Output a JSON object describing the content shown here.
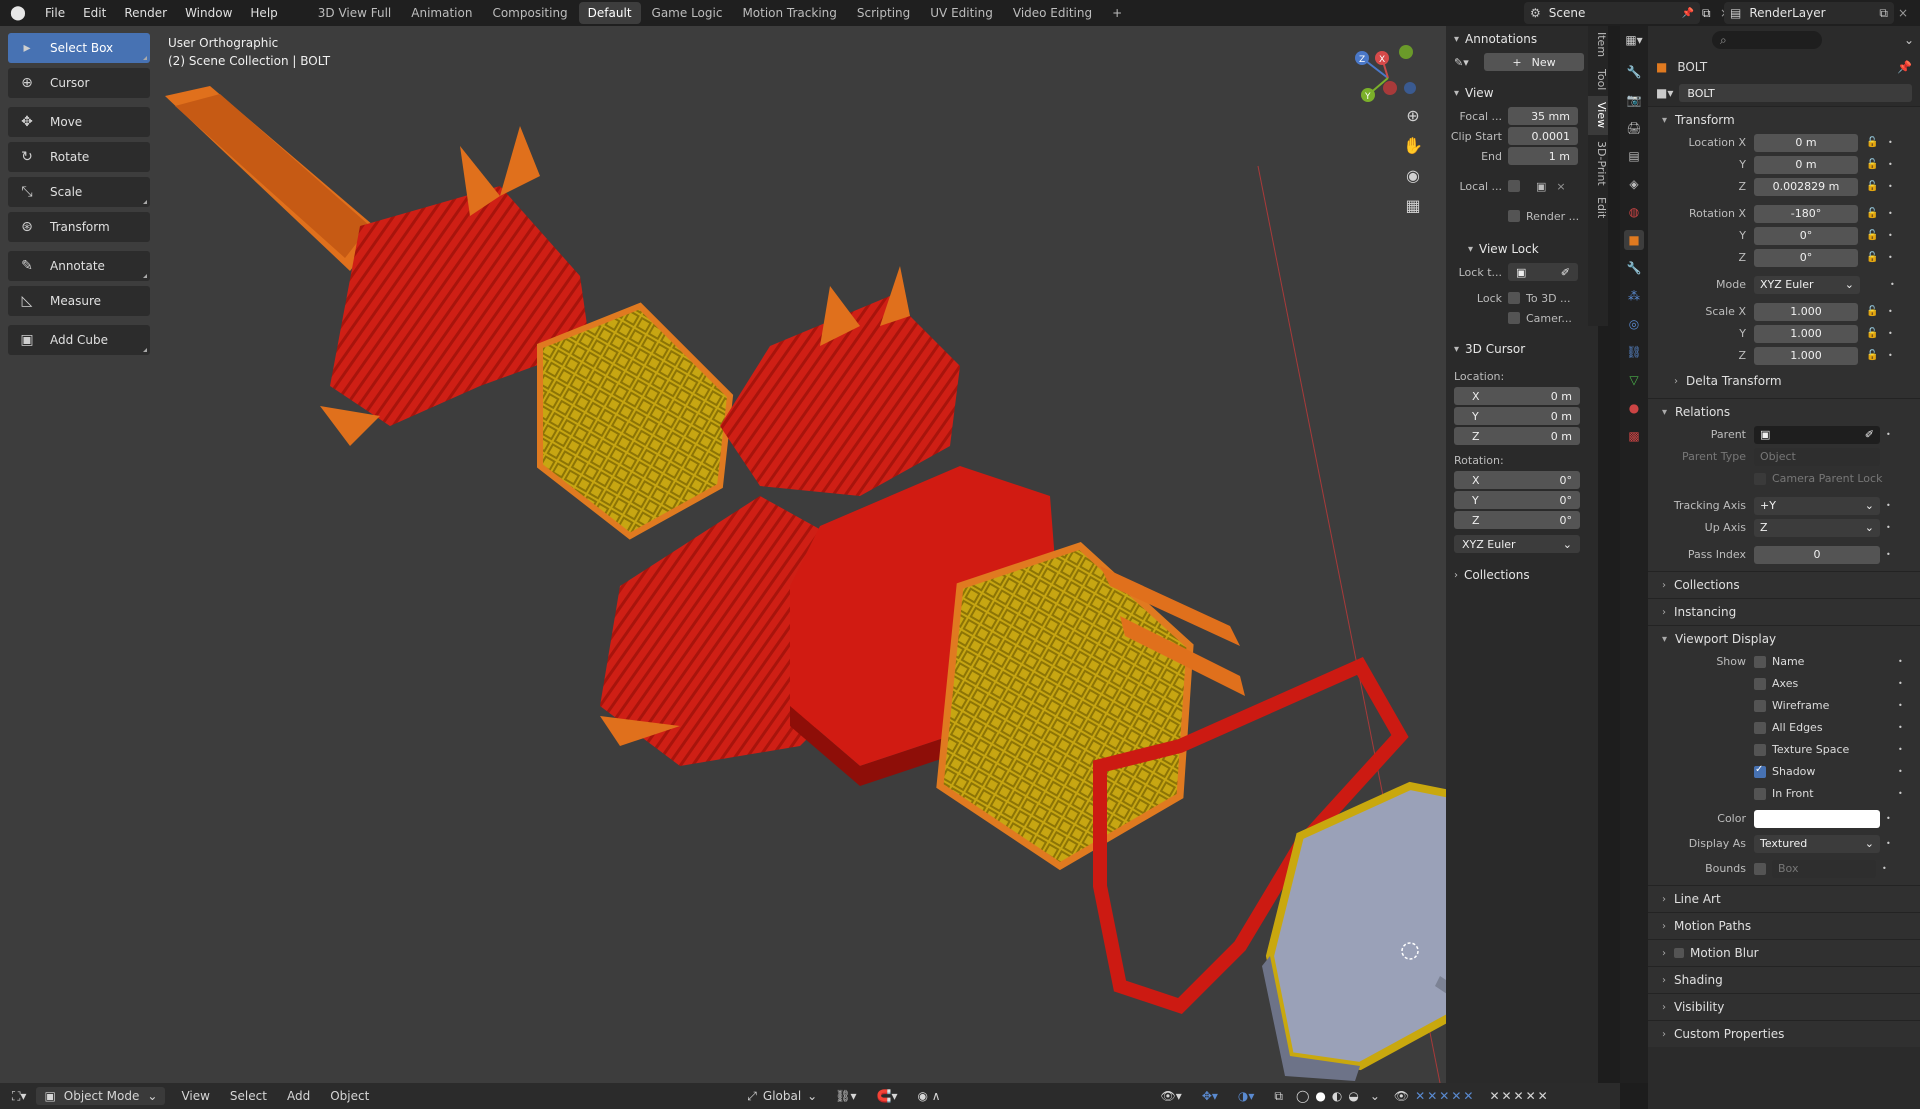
{
  "topbar": {
    "menus": [
      "File",
      "Edit",
      "Render",
      "Window",
      "Help"
    ],
    "workspaces": [
      "3D View Full",
      "Animation",
      "Compositing",
      "Default",
      "Game Logic",
      "Motion Tracking",
      "Scripting",
      "UV Editing",
      "Video Editing"
    ],
    "active_workspace": "Default",
    "add_workspace": "+",
    "scene": "Scene",
    "render_layer": "RenderLayer"
  },
  "toolbar": {
    "tools": [
      {
        "label": "Select Box",
        "icon": "select-box-icon",
        "glyph": "▸"
      },
      {
        "label": "Cursor",
        "icon": "cursor-icon",
        "glyph": "⊕"
      },
      {
        "label": "Move",
        "icon": "move-icon",
        "glyph": "✥"
      },
      {
        "label": "Rotate",
        "icon": "rotate-icon",
        "glyph": "↻"
      },
      {
        "label": "Scale",
        "icon": "scale-icon",
        "glyph": "⤡"
      },
      {
        "label": "Transform",
        "icon": "transform-icon",
        "glyph": "⊛"
      },
      {
        "label": "Annotate",
        "icon": "annotate-icon",
        "glyph": "✎"
      },
      {
        "label": "Measure",
        "icon": "measure-icon",
        "glyph": "📐"
      },
      {
        "label": "Add Cube",
        "icon": "add-cube-icon",
        "glyph": "▣"
      }
    ]
  },
  "viewport": {
    "view_name": "User Orthographic",
    "collection": "(2) Scene Collection | BOLT"
  },
  "npanel": {
    "annotations_title": "Annotations",
    "new_label": "New",
    "view_title": "View",
    "focal_label": "Focal ...",
    "focal_value": "35 mm",
    "clip_start_label": "Clip Start",
    "clip_start_value": "0.0001",
    "end_label": "End",
    "end_value": "1 m",
    "local_label": "Local ...",
    "render_label": "Render ...",
    "view_lock_title": "View Lock",
    "lock_to_label": "Lock t...",
    "lock_label": "Lock",
    "to_3d_label": "To 3D ...",
    "camera_label": "Camer...",
    "cursor_title": "3D Cursor",
    "location_label": "Location:",
    "loc_x": "0 m",
    "loc_y": "0 m",
    "loc_z": "0 m",
    "rotation_label": "Rotation:",
    "rot_x": "0°",
    "rot_y": "0°",
    "rot_z": "0°",
    "rot_mode": "XYZ Euler",
    "collections_title": "Collections",
    "x": "X",
    "y": "Y",
    "z": "Z",
    "tabs": [
      "Item",
      "Tool",
      "View",
      "3D-Print",
      "Edit"
    ]
  },
  "props": {
    "object_name": "BOLT",
    "data_name": "BOLT",
    "transform_title": "Transform",
    "location_x_label": "Location X",
    "location_x": "0 m",
    "location_y": "0 m",
    "location_z": "0.002829 m",
    "rotation_x_label": "Rotation X",
    "rotation_x": "-180°",
    "rotation_y": "0°",
    "rotation_z": "0°",
    "mode_label": "Mode",
    "mode_value": "XYZ Euler",
    "scale_x_label": "Scale X",
    "scale_x": "1.000",
    "scale_y": "1.000",
    "scale_z": "1.000",
    "y_label": "Y",
    "z_label": "Z",
    "delta_title": "Delta Transform",
    "relations_title": "Relations",
    "parent_label": "Parent",
    "parent_type_label": "Parent Type",
    "parent_type_value": "Object",
    "camera_parent_lock": "Camera Parent Lock",
    "tracking_axis_label": "Tracking Axis",
    "tracking_axis_value": "+Y",
    "up_axis_label": "Up Axis",
    "up_axis_value": "Z",
    "pass_index_label": "Pass Index",
    "pass_index_value": "0",
    "collections_title": "Collections",
    "instancing_title": "Instancing",
    "viewport_display_title": "Viewport Display",
    "show_label": "Show",
    "show_name": "Name",
    "show_axes": "Axes",
    "show_wireframe": "Wireframe",
    "show_all_edges": "All Edges",
    "show_texture_space": "Texture Space",
    "show_shadow": "Shadow",
    "show_in_front": "In Front",
    "color_label": "Color",
    "display_as_label": "Display As",
    "display_as_value": "Textured",
    "bounds_label": "Bounds",
    "bounds_value": "Box",
    "line_art_title": "Line Art",
    "motion_paths_title": "Motion Paths",
    "motion_blur_title": "Motion Blur",
    "shading_title": "Shading",
    "visibility_title": "Visibility",
    "custom_props_title": "Custom Properties"
  },
  "statusbar": {
    "mode": "Object Mode",
    "menus": [
      "View",
      "Select",
      "Add",
      "Object"
    ],
    "orientation": "Global"
  },
  "colors": {
    "accent": "#4772b3",
    "model_red": "#d41f14",
    "model_orange": "#e0701c",
    "model_yellow": "#c9a80e",
    "model_gray": "#9aa1b8"
  }
}
